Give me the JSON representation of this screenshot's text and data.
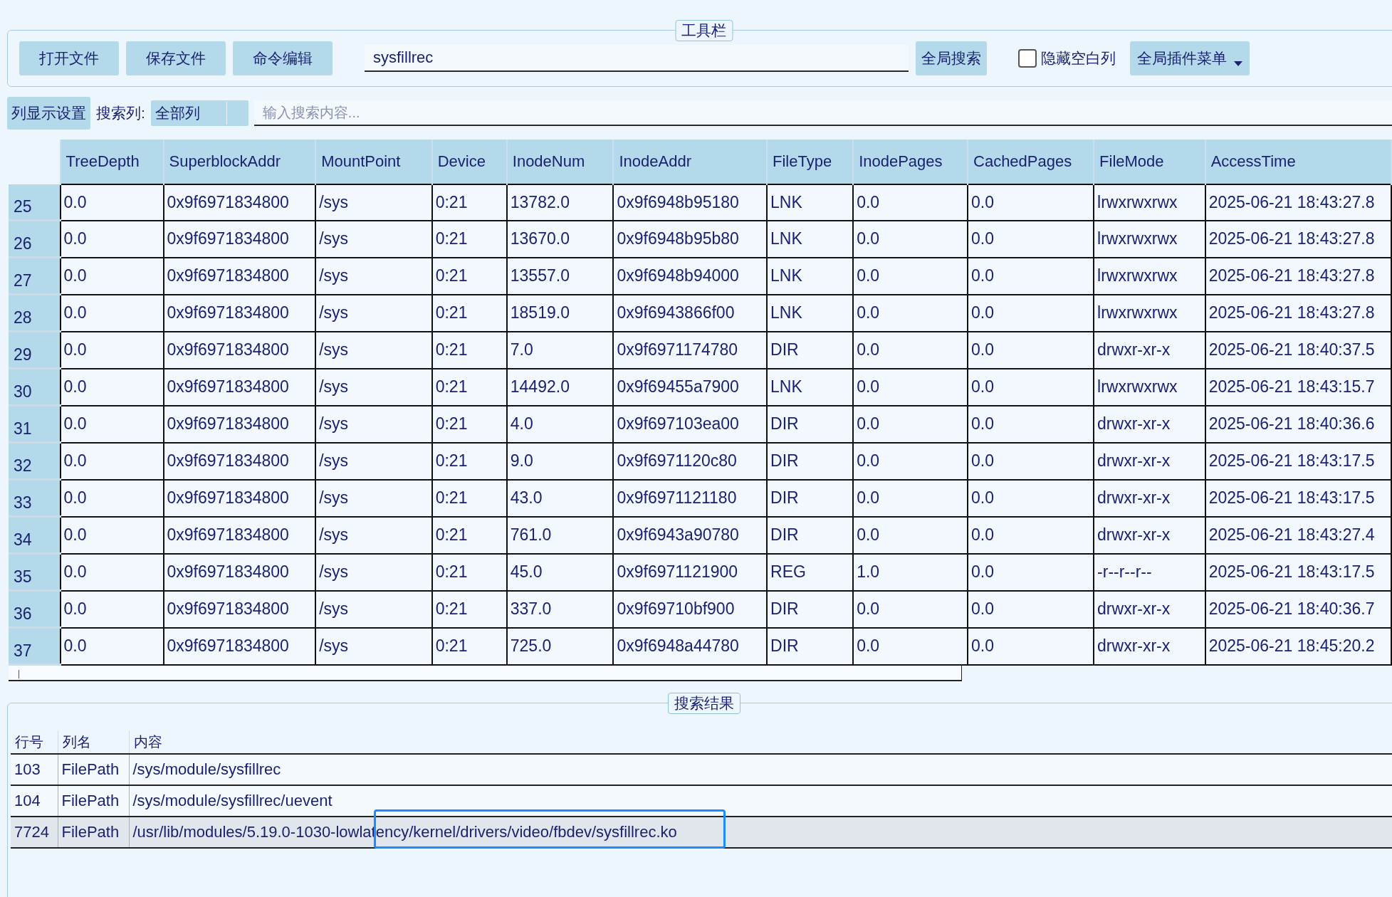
{
  "toolbar": {
    "title": "工具栏",
    "buttons": [
      "打开文件",
      "保存文件",
      "命令编辑"
    ],
    "search": {
      "value": "sysfillrec"
    },
    "search_button": "全局搜索",
    "hide_empty": {
      "label": "隐藏空白列",
      "checked": false
    },
    "plugin_menu": "全局插件菜单"
  },
  "filter_bar": {
    "column_settings": "列显示设置",
    "search_column_label": "搜索列:",
    "search_column": "全部列",
    "search": {
      "placeholder": "输入搜索内容..."
    }
  },
  "table": {
    "columns": [
      "TreeDepth",
      "SuperblockAddr",
      "MountPoint",
      "Device",
      "InodeNum",
      "InodeAddr",
      "FileType",
      "InodePages",
      "CachedPages",
      "FileMode",
      "AccessTime"
    ],
    "rows": [
      {
        "num": "25",
        "cells": [
          "0.0",
          "0x9f6971834800",
          "/sys",
          "0:21",
          "13782.0",
          "0x9f6948b95180",
          "LNK",
          "0.0",
          "0.0",
          "lrwxrwxrwx",
          "2025-06-21 18:43:27.8"
        ]
      },
      {
        "num": "26",
        "cells": [
          "0.0",
          "0x9f6971834800",
          "/sys",
          "0:21",
          "13670.0",
          "0x9f6948b95b80",
          "LNK",
          "0.0",
          "0.0",
          "lrwxrwxrwx",
          "2025-06-21 18:43:27.8"
        ]
      },
      {
        "num": "27",
        "cells": [
          "0.0",
          "0x9f6971834800",
          "/sys",
          "0:21",
          "13557.0",
          "0x9f6948b94000",
          "LNK",
          "0.0",
          "0.0",
          "lrwxrwxrwx",
          "2025-06-21 18:43:27.8"
        ]
      },
      {
        "num": "28",
        "cells": [
          "0.0",
          "0x9f6971834800",
          "/sys",
          "0:21",
          "18519.0",
          "0x9f6943866f00",
          "LNK",
          "0.0",
          "0.0",
          "lrwxrwxrwx",
          "2025-06-21 18:43:27.8"
        ]
      },
      {
        "num": "29",
        "cells": [
          "0.0",
          "0x9f6971834800",
          "/sys",
          "0:21",
          "7.0",
          "0x9f6971174780",
          "DIR",
          "0.0",
          "0.0",
          "drwxr-xr-x",
          "2025-06-21 18:40:37.5"
        ]
      },
      {
        "num": "30",
        "cells": [
          "0.0",
          "0x9f6971834800",
          "/sys",
          "0:21",
          "14492.0",
          "0x9f69455a7900",
          "LNK",
          "0.0",
          "0.0",
          "lrwxrwxrwx",
          "2025-06-21 18:43:15.7"
        ]
      },
      {
        "num": "31",
        "cells": [
          "0.0",
          "0x9f6971834800",
          "/sys",
          "0:21",
          "4.0",
          "0x9f697103ea00",
          "DIR",
          "0.0",
          "0.0",
          "drwxr-xr-x",
          "2025-06-21 18:40:36.6"
        ]
      },
      {
        "num": "32",
        "cells": [
          "0.0",
          "0x9f6971834800",
          "/sys",
          "0:21",
          "9.0",
          "0x9f6971120c80",
          "DIR",
          "0.0",
          "0.0",
          "drwxr-xr-x",
          "2025-06-21 18:43:17.5"
        ]
      },
      {
        "num": "33",
        "cells": [
          "0.0",
          "0x9f6971834800",
          "/sys",
          "0:21",
          "43.0",
          "0x9f6971121180",
          "DIR",
          "0.0",
          "0.0",
          "drwxr-xr-x",
          "2025-06-21 18:43:17.5"
        ]
      },
      {
        "num": "34",
        "cells": [
          "0.0",
          "0x9f6971834800",
          "/sys",
          "0:21",
          "761.0",
          "0x9f6943a90780",
          "DIR",
          "0.0",
          "0.0",
          "drwxr-xr-x",
          "2025-06-21 18:43:27.4"
        ]
      },
      {
        "num": "35",
        "cells": [
          "0.0",
          "0x9f6971834800",
          "/sys",
          "0:21",
          "45.0",
          "0x9f6971121900",
          "REG",
          "1.0",
          "0.0",
          "-r--r--r--",
          "2025-06-21 18:43:17.5"
        ]
      },
      {
        "num": "36",
        "cells": [
          "0.0",
          "0x9f6971834800",
          "/sys",
          "0:21",
          "337.0",
          "0x9f69710bf900",
          "DIR",
          "0.0",
          "0.0",
          "drwxr-xr-x",
          "2025-06-21 18:40:36.7"
        ]
      },
      {
        "num": "37",
        "cells": [
          "0.0",
          "0x9f6971834800",
          "/sys",
          "0:21",
          "725.0",
          "0x9f6948a44780",
          "DIR",
          "0.0",
          "0.0",
          "drwxr-xr-x",
          "2025-06-21 18:45:20.2"
        ]
      }
    ]
  },
  "results": {
    "title": "搜索结果",
    "columns": [
      "行号",
      "列名",
      "内容"
    ],
    "rows": [
      {
        "line": "103",
        "column": "FilePath",
        "content": "/sys/module/sysfillrec",
        "selected": false
      },
      {
        "line": "104",
        "column": "FilePath",
        "content": "/sys/module/sysfillrec/uevent",
        "selected": false
      },
      {
        "line": "7724",
        "column": "FilePath",
        "content": "/usr/lib/modules/5.19.0-1030-lowlatency/kernel/drivers/video/fbdev/sysfillrec.ko",
        "selected": true
      }
    ]
  }
}
